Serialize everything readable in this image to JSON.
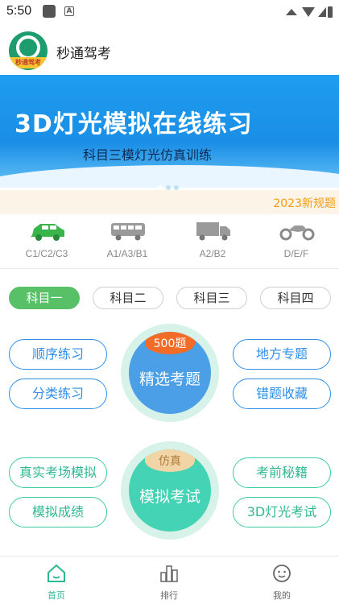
{
  "status_bar": {
    "time": "5:50"
  },
  "app": {
    "title": "秒通驾考",
    "logo_text": "秒通驾考"
  },
  "banner": {
    "headline": "3D灯光模拟在线练习",
    "subline": "科目三模灯光仿真训练",
    "dots": 3,
    "active_dot": 0
  },
  "notice": {
    "text": "2023新规题"
  },
  "vehicles": [
    {
      "label": "C1/C2/C3",
      "icon": "car-icon",
      "selected": true
    },
    {
      "label": "A1/A3/B1",
      "icon": "bus-icon",
      "selected": false
    },
    {
      "label": "A2/B2",
      "icon": "truck-icon",
      "selected": false
    },
    {
      "label": "D/E/F",
      "icon": "motorcycle-icon",
      "selected": false
    }
  ],
  "subjects": [
    {
      "label": "科目一",
      "active": true
    },
    {
      "label": "科目二",
      "active": false
    },
    {
      "label": "科目三",
      "active": false
    },
    {
      "label": "科目四",
      "active": false
    }
  ],
  "practice": {
    "left": [
      "顺序练习",
      "分类练习"
    ],
    "right": [
      "地方专题",
      "错题收藏"
    ],
    "center": {
      "badge": "500题",
      "label": "精选考题"
    }
  },
  "exam": {
    "left": [
      "真实考场模拟",
      "模拟成绩"
    ],
    "right": [
      "考前秘籍",
      "3D灯光考试"
    ],
    "center": {
      "badge": "仿真",
      "label": "模拟考试"
    }
  },
  "bottom_nav": [
    {
      "label": "首页",
      "icon": "home-icon",
      "active": true
    },
    {
      "label": "排行",
      "icon": "ranking-icon",
      "active": false
    },
    {
      "label": "我的",
      "icon": "profile-icon",
      "active": false
    }
  ],
  "colors": {
    "green": "#58c168",
    "blue": "#2f8fe8",
    "teal": "#3ccaa8",
    "orange": "#f39c12"
  }
}
